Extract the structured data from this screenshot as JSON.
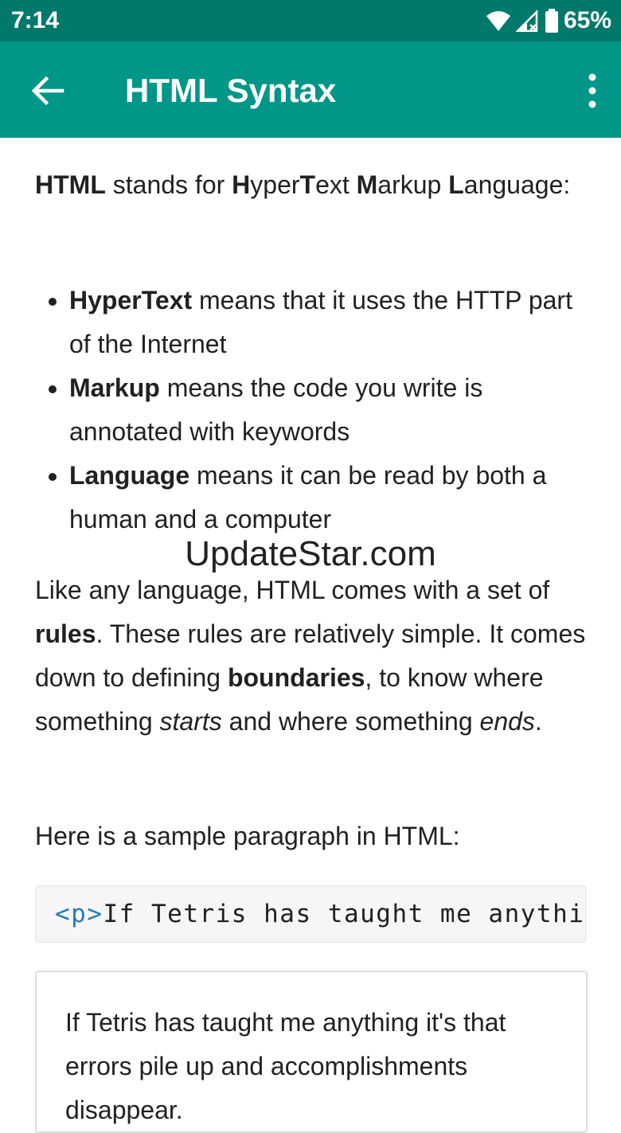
{
  "status_bar": {
    "time": "7:14",
    "battery": "65%"
  },
  "app_bar": {
    "title": "HTML Syntax"
  },
  "content": {
    "intro": {
      "b1": "HTML",
      "t1": " stands for ",
      "b2": "H",
      "t2": "yper",
      "b3": "T",
      "t3": "ext ",
      "b4": "M",
      "t4": "arkup ",
      "b5": "L",
      "t5": "anguage:"
    },
    "bullets": [
      {
        "term": "HyperText",
        "text": " means that it uses the HTTP part of the Internet"
      },
      {
        "term": "Markup",
        "text": " means the code you write is annotated with keywords"
      },
      {
        "term": "Language",
        "text": " means it can be read by both a human and a computer"
      }
    ],
    "watermark": "UpdateStar.com",
    "rules_para": {
      "t1": "Like any language, HTML comes with a set of ",
      "b1": "rules",
      "t2": ". These rules are relatively simple. It comes down to defining ",
      "b2": "boundaries",
      "t3": ", to know where something ",
      "i1": "starts",
      "t4": " and where something ",
      "i2": "ends",
      "t5": "."
    },
    "sample_intro": "Here is a sample paragraph in HTML:",
    "code": {
      "tag": "<p>",
      "text": "If Tetris has taught me anythin"
    },
    "rendered": "If Tetris has taught me anything it's that errors pile up and accomplishments disappear."
  },
  "colors": {
    "status_bar": "#00796b",
    "app_bar": "#009688",
    "code_tag": "#2a7ab8"
  }
}
